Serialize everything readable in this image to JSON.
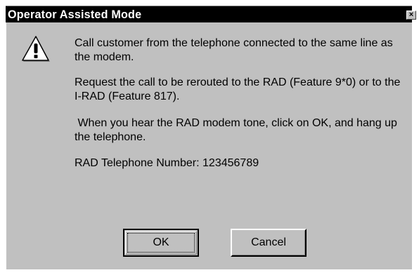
{
  "window": {
    "title": "Operator Assisted Mode",
    "close_glyph": "×"
  },
  "message": {
    "icon": "warning-icon",
    "paragraphs": [
      "Call customer from the telephone connected to the same line as the modem.",
      "Request the call to be rerouted to the RAD (Feature 9*0) or to the I-RAD (Feature 817).",
      " When you hear the RAD modem tone, click on OK, and hang up the telephone.",
      "RAD Telephone Number: 123456789"
    ]
  },
  "buttons": {
    "ok_label": "OK",
    "cancel_label": "Cancel"
  },
  "colors": {
    "titlebar": "#000000",
    "face": "#c0c0c0",
    "warning_fill": "#ffffff"
  }
}
